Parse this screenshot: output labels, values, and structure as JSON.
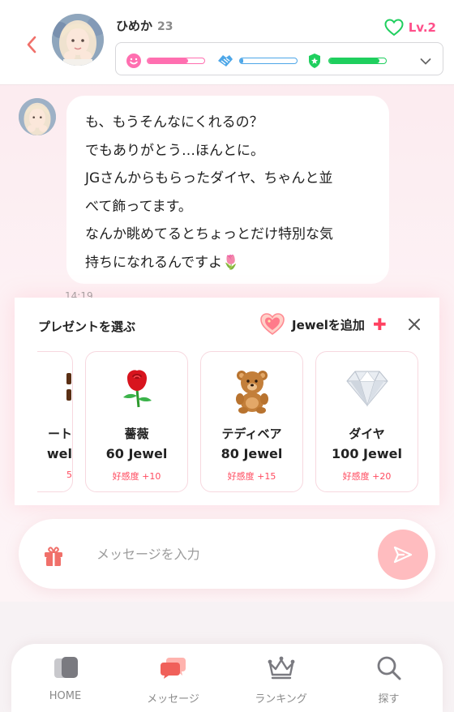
{
  "header": {
    "name": "ひめか",
    "age": "23",
    "level": "Lv.2",
    "gauges": {
      "smile": {
        "icon": "smile-icon",
        "color": "#ff6fb0",
        "value": 0.72
      },
      "trust": {
        "icon": "handshake-icon",
        "color": "#4ea7e8",
        "value": 0.05
      },
      "shield": {
        "icon": "shield-star-icon",
        "color": "#1fcf5e",
        "value": 0.88
      }
    }
  },
  "chat": {
    "lines": [
      "も、もうそんなにくれるの？",
      "でもありがとう…ほんとに。",
      "JGさんからもらったダイヤ、ちゃんと並",
      "べて飾ってます。",
      "なんか眺めてるとちょっとだけ特別な気",
      "持ちになれるんですよ🌷"
    ],
    "time": "14:19"
  },
  "gift_panel": {
    "title": "プレゼントを選ぶ",
    "add_jewel": "Jewelを追加",
    "items": [
      {
        "name": "ート",
        "price": "wel",
        "affinity": "5",
        "icon": "chocolate-icon"
      },
      {
        "name": "薔薇",
        "price": "60 Jewel",
        "affinity": "好感度 +10",
        "icon": "rose-icon"
      },
      {
        "name": "テディベア",
        "price": "80 Jewel",
        "affinity": "好感度 +15",
        "icon": "teddy-bear-icon"
      },
      {
        "name": "ダイヤ",
        "price": "100 Jewel",
        "affinity": "好感度 +20",
        "icon": "diamond-icon"
      }
    ]
  },
  "input": {
    "placeholder": "メッセージを入力",
    "value": ""
  },
  "nav": {
    "items": [
      {
        "label": "HOME",
        "icon": "home-cards-icon",
        "active": false
      },
      {
        "label": "メッセージ",
        "icon": "chat-bubbles-icon",
        "active": true
      },
      {
        "label": "ランキング",
        "icon": "crown-icon",
        "active": false
      },
      {
        "label": "探す",
        "icon": "search-icon",
        "active": false
      }
    ]
  },
  "colors": {
    "accent_pink": "#ff4f8a",
    "level_green": "#1fcf5e",
    "send_button": "#ffbcbf",
    "active_nav": "#f0605a"
  }
}
